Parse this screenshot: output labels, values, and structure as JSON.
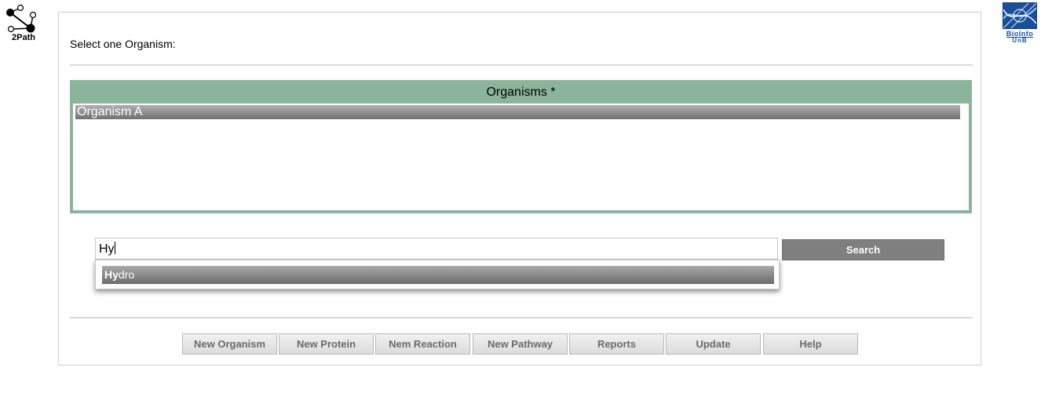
{
  "logos": {
    "left_label": "2Path",
    "right_line1": "BioInfo",
    "right_line2": "UnB"
  },
  "prompt": "Select one Organism:",
  "organisms": {
    "header": "Organisms *",
    "items": [
      "Organism A"
    ]
  },
  "search": {
    "value": "Hy",
    "button_label": "Search",
    "autocomplete": [
      {
        "match": "Hy",
        "rest": "dro"
      }
    ]
  },
  "nav": {
    "buttons": [
      "New Organism",
      "New Protein",
      "Nem Reaction",
      "New Pathway",
      "Reports",
      "Update",
      "Help"
    ]
  },
  "colors": {
    "organisms_accent": "#8bb59b",
    "search_button": "#7f7f7f",
    "selection": "#8a8a8a"
  }
}
